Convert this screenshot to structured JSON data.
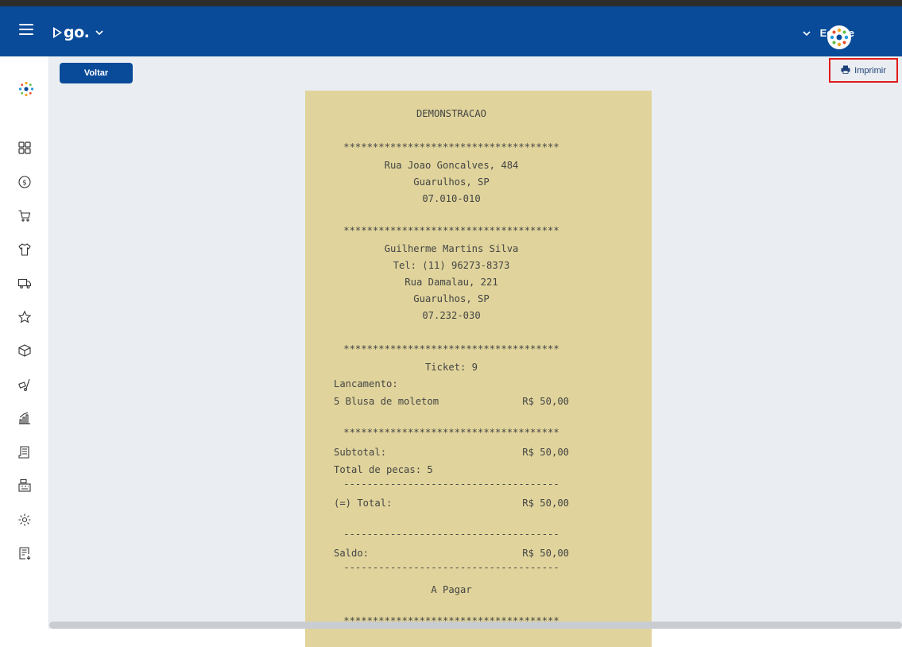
{
  "header": {
    "brand": "go.",
    "team_label": "Equipe",
    "colors": {
      "bar": "#0a4b99",
      "accent": "#e11b1b",
      "receipt": "#e0d49c"
    }
  },
  "sidebar": {
    "items": [
      {
        "icon": "dashboard-icon"
      },
      {
        "icon": "money-icon"
      },
      {
        "icon": "cart-icon"
      },
      {
        "icon": "shirt-icon"
      },
      {
        "icon": "truck-icon"
      },
      {
        "icon": "star-icon"
      },
      {
        "icon": "box-icon"
      },
      {
        "icon": "hand-truck-icon"
      },
      {
        "icon": "chart-icon"
      },
      {
        "icon": "receipt-icon"
      },
      {
        "icon": "cash-register-icon"
      },
      {
        "icon": "gear-icon"
      },
      {
        "icon": "list-icon"
      }
    ]
  },
  "toolbar": {
    "back_label": "Voltar",
    "print_label": "Imprimir"
  },
  "receipt": {
    "store_name": "DEMONSTRACAO",
    "separator": "*************************************",
    "store_address": "Rua Joao Goncalves, 484",
    "store_city": "Guarulhos, SP",
    "store_zip": "07.010-010",
    "customer_name": "Guilherme Martins Silva",
    "customer_phone": "Tel: (11) 96273-8373",
    "customer_address": "Rua Damalau, 221",
    "customer_city": "Guarulhos, SP",
    "customer_zip": "07.232-030",
    "ticket": "Ticket: 9",
    "entry_label": "Lancamento:",
    "item_desc": "5 Blusa de moletom",
    "item_price": "R$ 50,00",
    "subtotal_label": "Subtotal:",
    "subtotal_value": "R$ 50,00",
    "pieces_total": "Total de pecas: 5",
    "dash_line": "-------------------------------------",
    "total_label": "(=) Total:",
    "total_value": "R$ 50,00",
    "balance_label": "Saldo:",
    "balance_value": "R$ 50,00",
    "status": "A Pagar"
  }
}
